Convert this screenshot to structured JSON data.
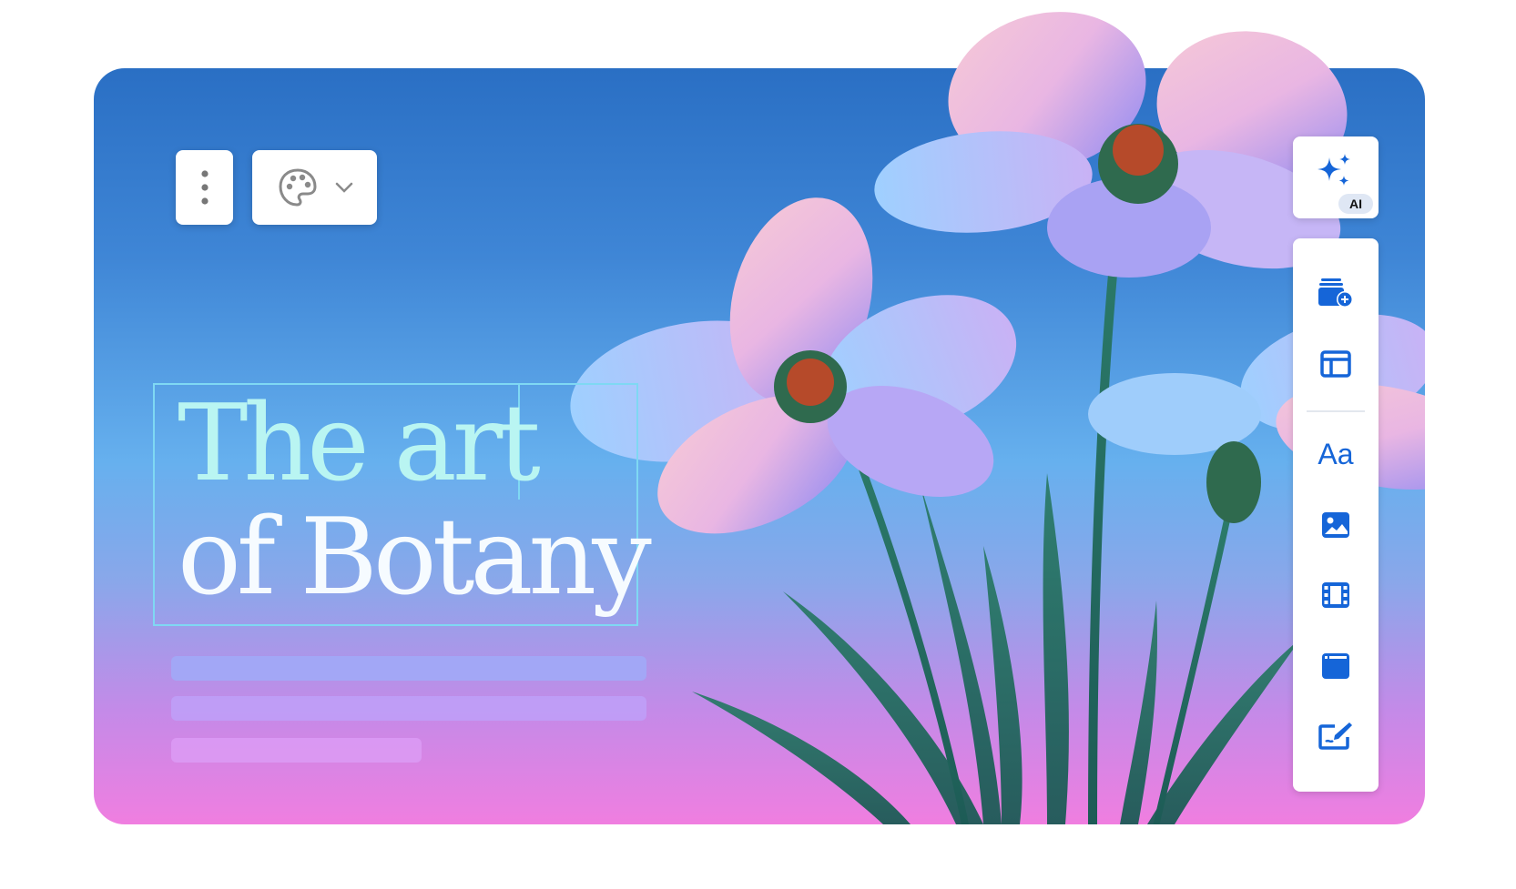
{
  "hero": {
    "title_line1": "The art",
    "title_line2": "of Botany"
  },
  "toolbar_top": {
    "more_icon": "more-vertical-icon",
    "palette_icon": "palette-icon",
    "dropdown_icon": "chevron-down-icon"
  },
  "ai": {
    "icon": "sparkles-icon",
    "badge": "AI"
  },
  "side_toolbar": {
    "items": [
      {
        "icon": "add-page-icon"
      },
      {
        "icon": "layout-icon"
      },
      {
        "icon": "text-icon",
        "label": "Aa"
      },
      {
        "icon": "image-icon"
      },
      {
        "icon": "video-icon"
      },
      {
        "icon": "embed-icon"
      },
      {
        "icon": "edit-icon"
      }
    ]
  },
  "colors": {
    "accent": "#1565d8",
    "title_primary": "#b9f5f2",
    "title_secondary": "#f6fbff",
    "selection_border": "#7fd8f3"
  }
}
